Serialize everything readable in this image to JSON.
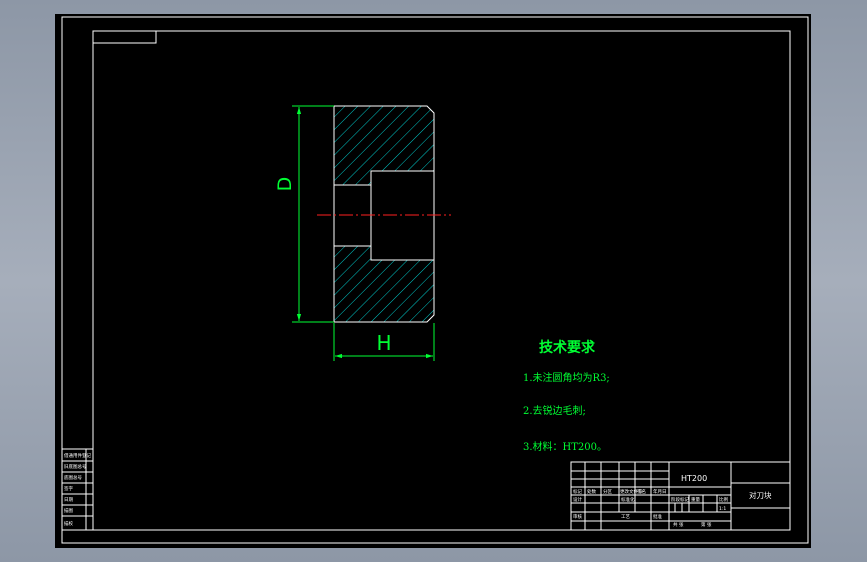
{
  "dimensions": {
    "diameter_label": "D",
    "width_label": "H"
  },
  "technical_requirements": {
    "title": "技术要求",
    "items": [
      "1.未注圆角均为R3;",
      "2.去锐边毛刺;",
      "3.材料：HT200。"
    ]
  },
  "title_block": {
    "material": "HT200",
    "part_name": "对刀块",
    "row_labels": [
      "标记",
      "设计",
      "审核"
    ],
    "header_labels": [
      "处数",
      "分区",
      "更改文件号",
      "签名",
      "年月日"
    ],
    "cell_labels": [
      "标准化",
      "工艺",
      "批准"
    ],
    "stage_labels": [
      "阶段标记",
      "重量",
      "比例"
    ],
    "scale": "1:1",
    "sheet_count": "共 张",
    "sheet_no": "第 张"
  },
  "left_block": {
    "rows": [
      "借通用件登记",
      "旧底图总号",
      "底图总号",
      "签字",
      "日期",
      "描图",
      "描校"
    ]
  },
  "colors": {
    "background": "#000000",
    "frame": "#ffffff",
    "outline": "#ffffff",
    "hatch": "#00c8c8",
    "dimension": "#00ff33",
    "centerline": "#ff2020",
    "notes": "#00ff33"
  }
}
